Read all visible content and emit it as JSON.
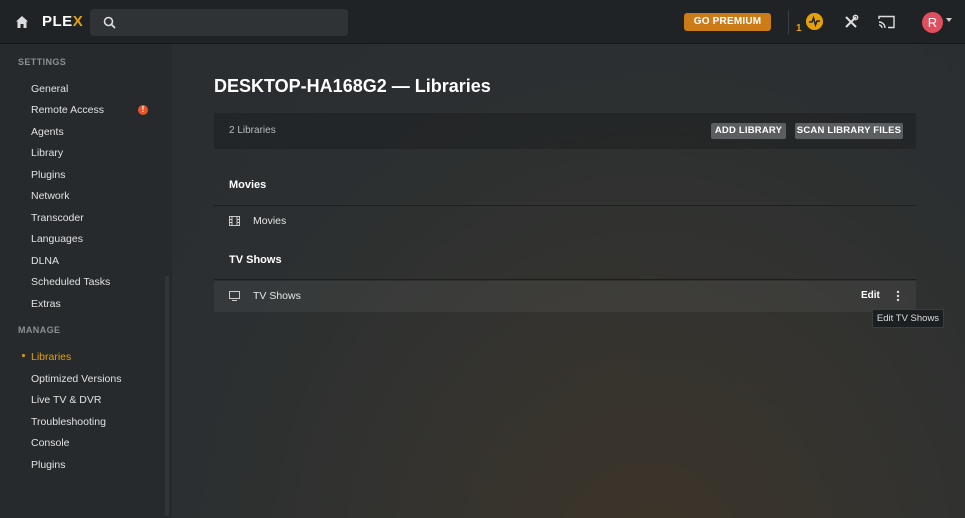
{
  "topbar": {
    "logo_main": "PLE",
    "logo_accent": "X",
    "search_placeholder": "",
    "premium_label": "GO PREMIUM",
    "activity_count": "1",
    "avatar_letter": "R"
  },
  "sidebar": {
    "settings_title": "SETTINGS",
    "settings_items": [
      {
        "label": "General"
      },
      {
        "label": "Remote Access"
      },
      {
        "label": "Agents"
      },
      {
        "label": "Library"
      },
      {
        "label": "Plugins"
      },
      {
        "label": "Network"
      },
      {
        "label": "Transcoder"
      },
      {
        "label": "Languages"
      },
      {
        "label": "DLNA"
      },
      {
        "label": "Scheduled Tasks"
      },
      {
        "label": "Extras"
      }
    ],
    "remote_access_warning": "!",
    "manage_title": "MANAGE",
    "manage_items": [
      {
        "label": "Libraries"
      },
      {
        "label": "Optimized Versions"
      },
      {
        "label": "Live TV & DVR"
      },
      {
        "label": "Troubleshooting"
      },
      {
        "label": "Console"
      },
      {
        "label": "Plugins"
      }
    ],
    "active_item": "Libraries"
  },
  "main": {
    "title": "DESKTOP-HA168G2 — Libraries",
    "library_count": "2 Libraries",
    "add_library_label": "ADD LIBRARY",
    "scan_label": "SCAN LIBRARY FILES",
    "groups": [
      {
        "header": "Movies",
        "libraries": [
          {
            "name": "Movies",
            "icon": "film-icon"
          }
        ]
      },
      {
        "header": "TV Shows",
        "libraries": [
          {
            "name": "TV Shows",
            "icon": "tv-icon"
          }
        ]
      }
    ],
    "edit_label": "Edit",
    "tooltip": "Edit TV Shows"
  },
  "colors": {
    "accent": "#e5a00d",
    "premium": "#cc7b19",
    "avatar": "#e04f5f",
    "warning": "#e5552a"
  }
}
